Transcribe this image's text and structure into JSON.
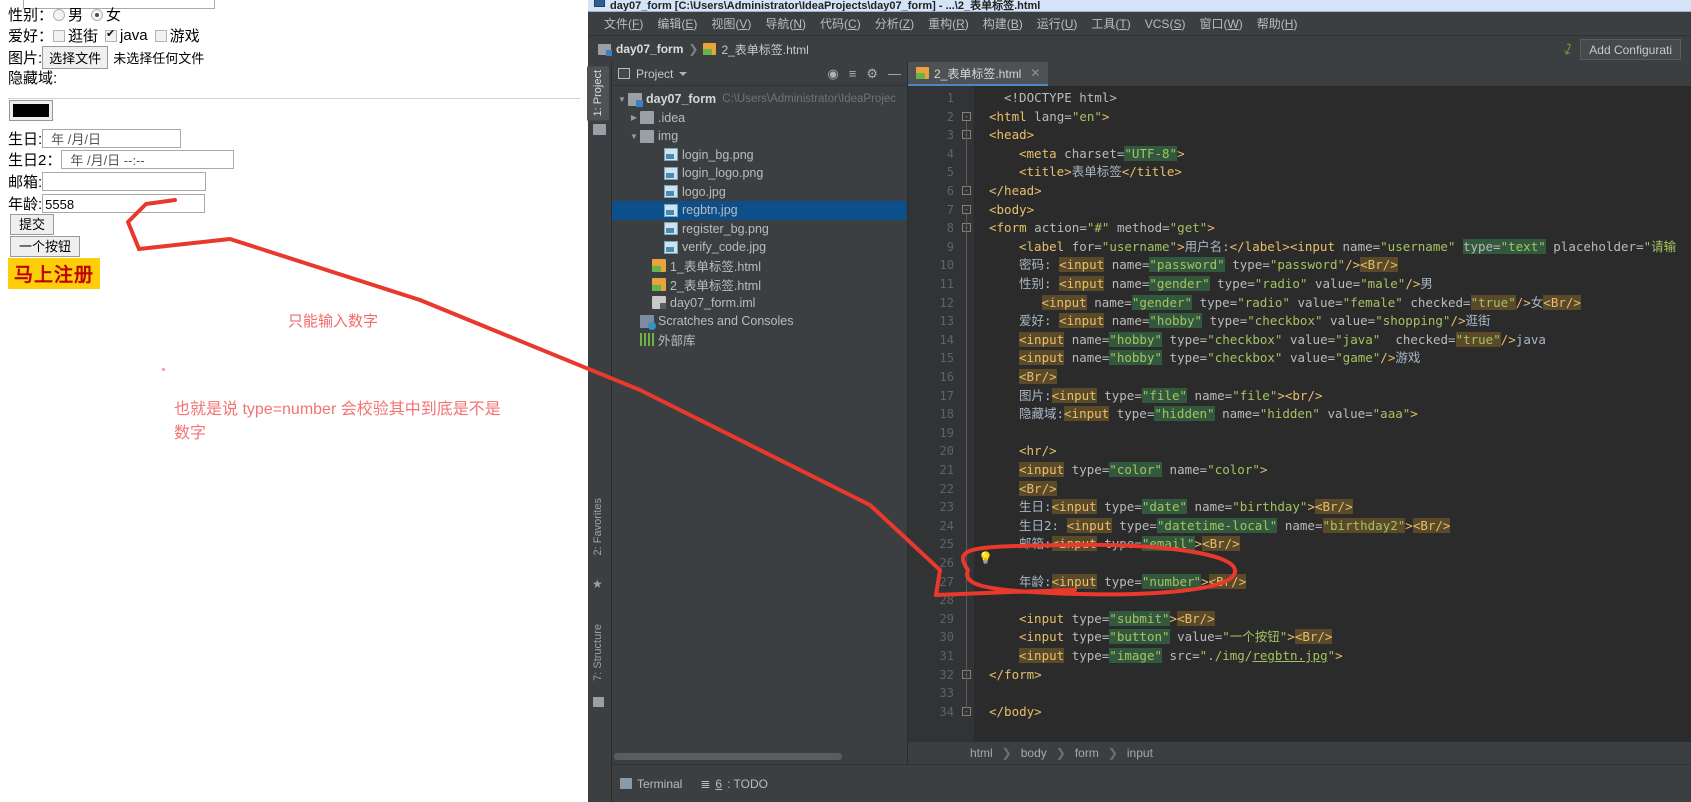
{
  "browser_form": {
    "gender_label": "性别：",
    "gender_options": [
      {
        "label": "男",
        "checked": false
      },
      {
        "label": "女",
        "checked": true
      }
    ],
    "hobby_label": "爱好：",
    "hobby_options": [
      {
        "label": "逛街",
        "checked": false
      },
      {
        "label": "java",
        "checked": true
      },
      {
        "label": "游戏",
        "checked": false
      }
    ],
    "image_label": "图片:",
    "file_button": "选择文件",
    "file_status": "未选择任何文件",
    "hidden_label": "隐藏域:",
    "color_value": "#000000",
    "birthday_label": "生日:",
    "birthday_placeholder": "年 /月/日",
    "birthday2_label": "生日2：",
    "birthday2_placeholder": "年 /月/日 --:--",
    "email_label": "邮箱:",
    "email_value": "",
    "age_label": "年龄:",
    "age_value": "5558",
    "submit_button": "提交",
    "plain_button": "一个按钮",
    "image_button": "马上注册"
  },
  "annotations": {
    "note1": "只能输入数字",
    "note2_line1": "也就是说 type=number 会校验其中到底是不是",
    "note2_line2": "数字",
    "color": "#ef5350"
  },
  "ide": {
    "window_title": "day07_form [C:\\Users\\Administrator\\IdeaProjects\\day07_form] - ...\\2_表单标签.html",
    "menu": [
      {
        "text": "文件",
        "mnemonic": "F"
      },
      {
        "text": "编辑",
        "mnemonic": "E"
      },
      {
        "text": "视图",
        "mnemonic": "V"
      },
      {
        "text": "导航",
        "mnemonic": "N"
      },
      {
        "text": "代码",
        "mnemonic": "C"
      },
      {
        "text": "分析",
        "mnemonic": "Z"
      },
      {
        "text": "重构",
        "mnemonic": "R"
      },
      {
        "text": "构建",
        "mnemonic": "B"
      },
      {
        "text": "运行",
        "mnemonic": "U"
      },
      {
        "text": "工具",
        "mnemonic": "T"
      },
      {
        "text": "VCS",
        "mnemonic": "S"
      },
      {
        "text": "窗口",
        "mnemonic": "W"
      },
      {
        "text": "帮助",
        "mnemonic": "H"
      }
    ],
    "navbar": {
      "project_crumb": "day07_form",
      "file_crumb": "2_表单标签.html",
      "add_configuration": "Add Configurati"
    },
    "left_rail": [
      {
        "label": "1: Project",
        "selected": true
      },
      {
        "label": "2: Favorites",
        "selected": false
      },
      {
        "label": "7: Structure",
        "selected": false
      }
    ],
    "project_panel": {
      "title": "Project",
      "tree": [
        {
          "indent": 0,
          "twisty": "▼",
          "icon": "mod",
          "label": "day07_form",
          "bold": true,
          "dim": "C:\\Users\\Administrator\\IdeaProjec",
          "selected": false
        },
        {
          "indent": 1,
          "twisty": "▶",
          "icon": "fold",
          "label": ".idea",
          "bold": false,
          "dim": "",
          "selected": false
        },
        {
          "indent": 1,
          "twisty": "▼",
          "icon": "fold",
          "label": "img",
          "bold": false,
          "dim": "",
          "selected": false
        },
        {
          "indent": 3,
          "twisty": "",
          "icon": "img",
          "label": "login_bg.png",
          "bold": false,
          "dim": "",
          "selected": false
        },
        {
          "indent": 3,
          "twisty": "",
          "icon": "img",
          "label": "login_logo.png",
          "bold": false,
          "dim": "",
          "selected": false
        },
        {
          "indent": 3,
          "twisty": "",
          "icon": "img",
          "label": "logo.jpg",
          "bold": false,
          "dim": "",
          "selected": false
        },
        {
          "indent": 3,
          "twisty": "",
          "icon": "img",
          "label": "regbtn.jpg",
          "bold": false,
          "dim": "",
          "selected": true
        },
        {
          "indent": 3,
          "twisty": "",
          "icon": "img",
          "label": "register_bg.png",
          "bold": false,
          "dim": "",
          "selected": false
        },
        {
          "indent": 3,
          "twisty": "",
          "icon": "img",
          "label": "verify_code.jpg",
          "bold": false,
          "dim": "",
          "selected": false
        },
        {
          "indent": 2,
          "twisty": "",
          "icon": "html",
          "label": "1_表单标签.html",
          "bold": false,
          "dim": "",
          "selected": false
        },
        {
          "indent": 2,
          "twisty": "",
          "icon": "html",
          "label": "2_表单标签.html",
          "bold": false,
          "dim": "",
          "selected": false
        },
        {
          "indent": 2,
          "twisty": "",
          "icon": "iml",
          "label": "day07_form.iml",
          "bold": false,
          "dim": "",
          "selected": false
        },
        {
          "indent": 1,
          "twisty": "",
          "icon": "scratch",
          "label": "Scratches and Consoles",
          "bold": false,
          "dim": "",
          "selected": false
        },
        {
          "indent": 1,
          "twisty": "",
          "icon": "lib",
          "label": "外部库",
          "bold": false,
          "dim": "",
          "selected": false
        }
      ]
    },
    "editor": {
      "tab_label": "2_表单标签.html",
      "breadcrumb": [
        "html",
        "body",
        "form",
        "input"
      ],
      "first_line": 1,
      "code_lines": [
        {
          "n": 1,
          "indent": 4,
          "fold": "",
          "html": "<span class=\"doct\">&lt;!DOCTYPE html&gt;</span>"
        },
        {
          "n": 2,
          "indent": 2,
          "fold": "-",
          "html": "<span class=\"tag\">&lt;html</span> <span class=\"attr\">lang=</span><span class=\"val\">\"en\"</span><span class=\"tag\">&gt;</span>"
        },
        {
          "n": 3,
          "indent": 2,
          "fold": "-",
          "html": "<span class=\"tag\">&lt;head&gt;</span>"
        },
        {
          "n": 4,
          "indent": 6,
          "fold": "",
          "html": "<span class=\"tag\">&lt;meta</span> <span class=\"attr\">charset=</span><span class=\"val hl\">\"UTF-8\"</span><span class=\"tag\">&gt;</span>"
        },
        {
          "n": 5,
          "indent": 6,
          "fold": "",
          "html": "<span class=\"tag\">&lt;title&gt;</span><span class=\"txt\">表单标签</span><span class=\"tag\">&lt;/title&gt;</span>"
        },
        {
          "n": 6,
          "indent": 2,
          "fold": "-",
          "html": "<span class=\"tag\">&lt;/head&gt;</span>"
        },
        {
          "n": 7,
          "indent": 2,
          "fold": "-",
          "html": "<span class=\"tag\">&lt;body&gt;</span>"
        },
        {
          "n": 8,
          "indent": 2,
          "fold": "-",
          "html": "<span class=\"tag\">&lt;form</span> <span class=\"attr\">action=</span><span class=\"val\">\"#\"</span> <span class=\"attr\">method=</span><span class=\"val\">\"get\"</span><span class=\"tag\">&gt;</span>"
        },
        {
          "n": 9,
          "indent": 6,
          "fold": "",
          "html": "<span class=\"tag\">&lt;label</span> <span class=\"attr\">for=</span><span class=\"val\">\"username\"</span><span class=\"tag\">&gt;</span><span class=\"txt\">用户名:</span><span class=\"tag\">&lt;/label&gt;&lt;input</span> <span class=\"attr\">name=</span><span class=\"val\">\"username\"</span> <span class=\"attr hl\">type=</span><span class=\"val hl\">\"text\"</span> <span class=\"attr\">placeholder=</span><span class=\"val\">\"请输</span>"
        },
        {
          "n": 10,
          "indent": 6,
          "fold": "",
          "html": "<span class=\"txt\">密码: </span><span class=\"tag hl2\">&lt;input</span> <span class=\"attr\">name=</span><span class=\"val hl\">\"password\"</span> <span class=\"attr\">type=</span><span class=\"val\">\"password\"</span><span class=\"tag\">/&gt;</span><span class=\"tag hl2\">&lt;Br/&gt;</span>"
        },
        {
          "n": 11,
          "indent": 6,
          "fold": "",
          "html": "<span class=\"txt\">性别: </span><span class=\"tag hl2\">&lt;input</span> <span class=\"attr\">name=</span><span class=\"val hl\">\"gender\"</span> <span class=\"attr\">type=</span><span class=\"val\">\"radio\"</span> <span class=\"attr\">value=</span><span class=\"val\">\"male\"</span><span class=\"tag\">/&gt;</span><span class=\"txt\">男</span>"
        },
        {
          "n": 12,
          "indent": 9,
          "fold": "",
          "html": "<span class=\"tag hl2\">&lt;input</span> <span class=\"attr\">name=</span><span class=\"val hl\">\"gender\"</span> <span class=\"attr\">type=</span><span class=\"val\">\"radio\"</span> <span class=\"attr\">value=</span><span class=\"val\">\"female\"</span> <span class=\"attr\">checked=</span><span class=\"val hl2\">\"true\"</span><span class=\"tag\">/&gt;</span><span class=\"txt\">女</span><span class=\"tag hl2\">&lt;Br/&gt;</span>"
        },
        {
          "n": 13,
          "indent": 6,
          "fold": "",
          "html": "<span class=\"txt\">爱好: </span><span class=\"tag hl2\">&lt;input</span> <span class=\"attr\">name=</span><span class=\"val hl\">\"hobby\"</span> <span class=\"attr\">type=</span><span class=\"val\">\"checkbox\"</span> <span class=\"attr\">value=</span><span class=\"val\">\"shopping\"</span><span class=\"tag\">/&gt;</span><span class=\"txt\">逛街</span>"
        },
        {
          "n": 14,
          "indent": 6,
          "fold": "",
          "html": "<span class=\"tag hl2\">&lt;input</span> <span class=\"attr\">name=</span><span class=\"val hl\">\"hobby\"</span> <span class=\"attr\">type=</span><span class=\"val\">\"checkbox\"</span> <span class=\"attr\">value=</span><span class=\"val\">\"java\"</span>  <span class=\"attr\">checked=</span><span class=\"val hl2\">\"true\"</span><span class=\"tag\">/&gt;</span><span class=\"txt\">java</span>"
        },
        {
          "n": 15,
          "indent": 6,
          "fold": "",
          "html": "<span class=\"tag hl2\">&lt;input</span> <span class=\"attr\">name=</span><span class=\"val hl\">\"hobby\"</span> <span class=\"attr\">type=</span><span class=\"val\">\"checkbox\"</span> <span class=\"attr\">value=</span><span class=\"val\">\"game\"</span><span class=\"tag\">/&gt;</span><span class=\"txt\">游戏</span>"
        },
        {
          "n": 16,
          "indent": 6,
          "fold": "",
          "html": "<span class=\"tag hl2\">&lt;Br/&gt;</span>"
        },
        {
          "n": 17,
          "indent": 6,
          "fold": "",
          "html": "<span class=\"txt\">图片:</span><span class=\"tag hl2\">&lt;input</span> <span class=\"attr\">type=</span><span class=\"val hl\">\"file\"</span> <span class=\"attr\">name=</span><span class=\"val\">\"file\"</span><span class=\"tag\">&gt;&lt;br/&gt;</span>"
        },
        {
          "n": 18,
          "indent": 6,
          "fold": "",
          "html": "<span class=\"txt\">隐藏域:</span><span class=\"tag hl2\">&lt;input</span> <span class=\"attr\">type=</span><span class=\"val hl\">\"hidden\"</span> <span class=\"attr\">name=</span><span class=\"val\">\"hidden\"</span> <span class=\"attr\">value=</span><span class=\"val\">\"aaa\"</span><span class=\"tag\">&gt;</span>"
        },
        {
          "n": 19,
          "indent": 0,
          "fold": "",
          "html": ""
        },
        {
          "n": 20,
          "indent": 6,
          "fold": "",
          "html": "<span class=\"tag\">&lt;hr/&gt;</span>"
        },
        {
          "n": 21,
          "indent": 6,
          "fold": "",
          "html": "<span class=\"tag hl2\">&lt;input</span> <span class=\"attr\">type=</span><span class=\"val hl\">\"color\"</span> <span class=\"attr\">name=</span><span class=\"val\">\"color\"</span><span class=\"tag\">&gt;</span>"
        },
        {
          "n": 22,
          "indent": 6,
          "fold": "",
          "html": "<span class=\"tag hl2\">&lt;Br/&gt;</span>"
        },
        {
          "n": 23,
          "indent": 6,
          "fold": "",
          "html": "<span class=\"txt\">生日:</span><span class=\"tag hl2\">&lt;input</span> <span class=\"attr\">type=</span><span class=\"val hl\">\"date\"</span> <span class=\"attr\">name=</span><span class=\"val\">\"birthday\"</span><span class=\"tag\">&gt;</span><span class=\"tag hl2\">&lt;Br/&gt;</span>"
        },
        {
          "n": 24,
          "indent": 6,
          "fold": "",
          "html": "<span class=\"txt\">生日2: </span><span class=\"tag hl2\">&lt;input</span> <span class=\"attr\">type=</span><span class=\"val hl\">\"datetime-local\"</span> <span class=\"attr\">name=</span><span class=\"val hl2\">\"birthday2\"</span><span class=\"tag\">&gt;</span><span class=\"tag hl2\">&lt;Br/&gt;</span>"
        },
        {
          "n": 25,
          "indent": 6,
          "fold": "",
          "html": "<span class=\"txt\">邮箱:</span><span class=\"tag hl2\">&lt;input</span> <span class=\"attr\">type=</span><span class=\"val hl\">\"email\"</span><span class=\"tag\">&gt;</span><span class=\"tag hl2\">&lt;Br/&gt;</span>"
        },
        {
          "n": 26,
          "indent": 0,
          "fold": "",
          "html": ""
        },
        {
          "n": 27,
          "indent": 6,
          "fold": "",
          "html": "<span class=\"txt\">年龄:</span><span class=\"tag hl2\">&lt;input</span> <span class=\"attr\">type=</span><span class=\"val hl\">\"number</span><span class=\"caret\"></span><span class=\"val hl\">\"</span><span class=\"tag\">&gt;</span><span class=\"tag hl2\">&lt;Br/&gt;</span>"
        },
        {
          "n": 28,
          "indent": 0,
          "fold": "",
          "html": ""
        },
        {
          "n": 29,
          "indent": 6,
          "fold": "",
          "html": "<span class=\"tag\">&lt;input</span> <span class=\"attr\">type=</span><span class=\"val hl\">\"submit\"</span><span class=\"tag\">&gt;</span><span class=\"tag hl2\">&lt;Br/&gt;</span>"
        },
        {
          "n": 30,
          "indent": 6,
          "fold": "",
          "html": "<span class=\"tag\">&lt;input</span> <span class=\"attr\">type=</span><span class=\"val hl\">\"button\"</span> <span class=\"attr\">value=</span><span class=\"val\">\"一个按钮\"</span><span class=\"tag\">&gt;</span><span class=\"tag hl2\">&lt;Br/&gt;</span>"
        },
        {
          "n": 31,
          "indent": 6,
          "fold": "",
          "html": "<span class=\"tag hl2\">&lt;input</span> <span class=\"attr\">type=</span><span class=\"val hl\">\"image\"</span> <span class=\"attr\">src=</span><span class=\"val\">\"./img/</span><span class=\"val\" style=\"text-decoration:underline\">regbtn.jpg</span><span class=\"val\">\"</span><span class=\"tag\">&gt;</span>"
        },
        {
          "n": 32,
          "indent": 2,
          "fold": "-",
          "html": "<span class=\"tag\">&lt;/form&gt;</span>"
        },
        {
          "n": 33,
          "indent": 0,
          "fold": "",
          "html": ""
        },
        {
          "n": 34,
          "indent": 2,
          "fold": "-",
          "html": "<span class=\"tag\">&lt;/body&gt;</span>"
        }
      ]
    },
    "status_bar": {
      "terminal": "Terminal",
      "todo_num": "6",
      "todo_label": ": TODO"
    }
  }
}
